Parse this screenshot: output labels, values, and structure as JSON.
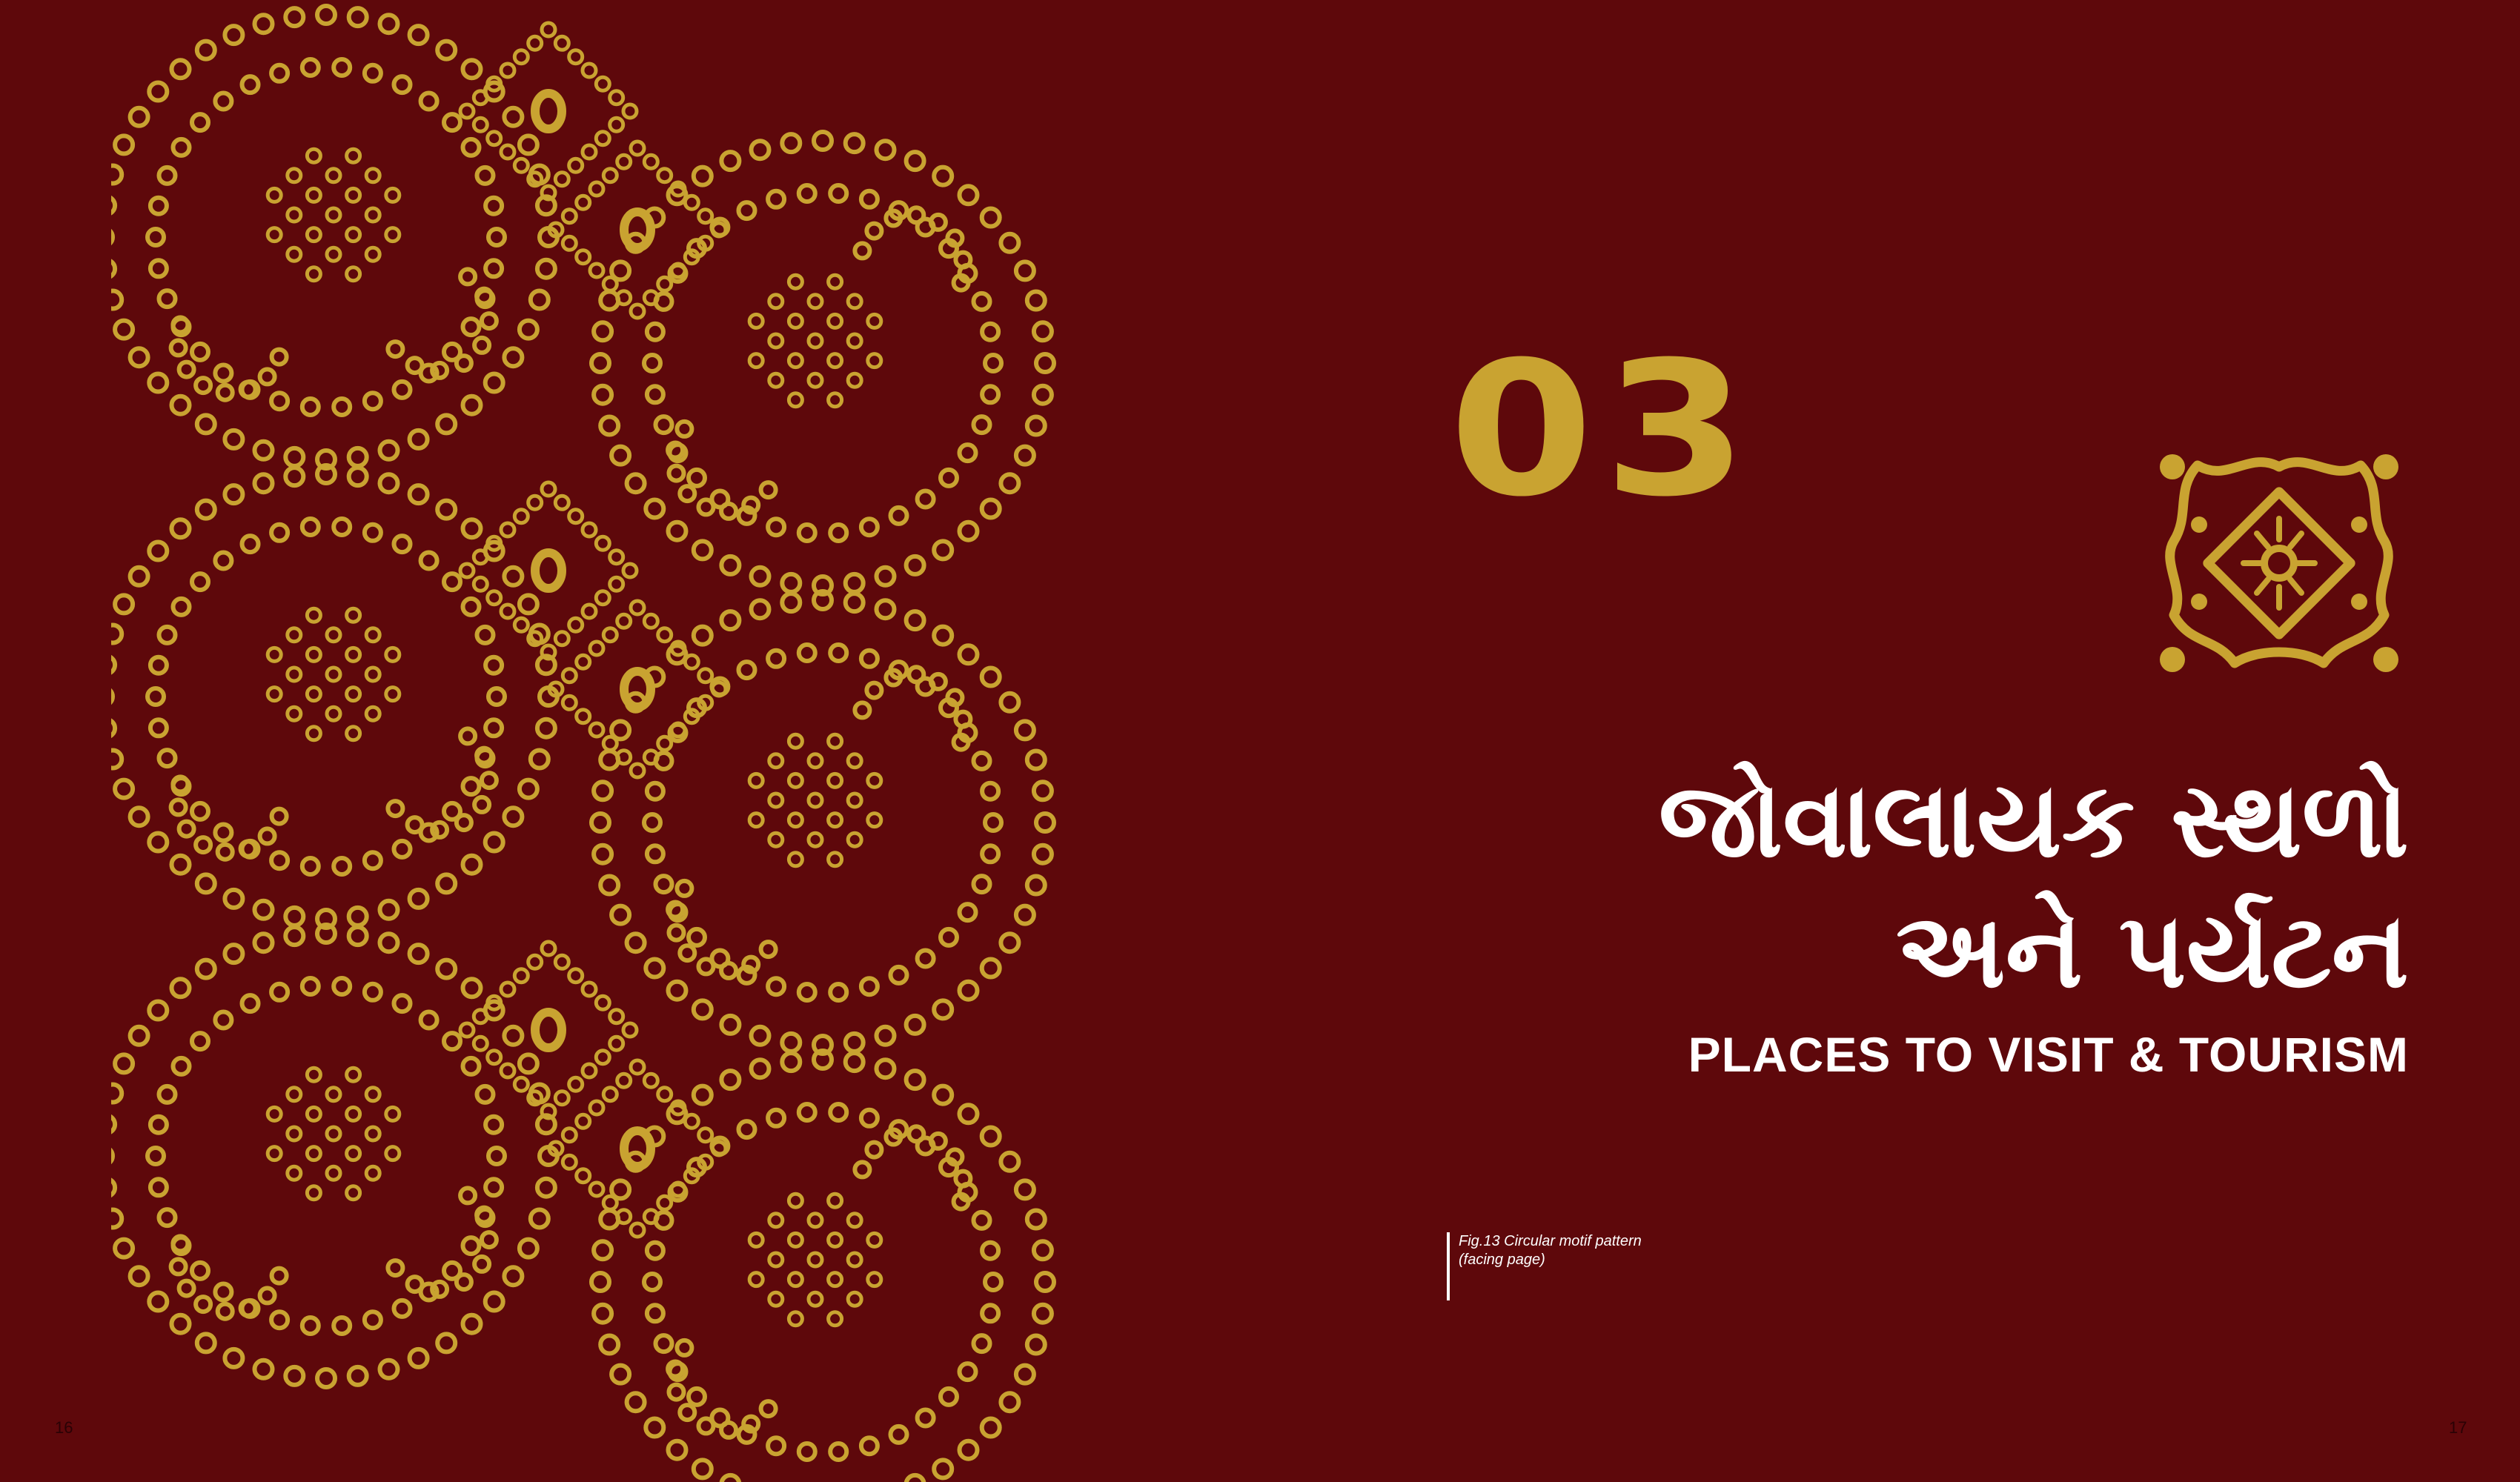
{
  "left_page": {
    "pattern_icon": "bandhani-dot-pattern",
    "page_number": "16"
  },
  "right_page": {
    "chapter_number": "03",
    "ornament_icon": "bandhani-square-motif",
    "title_gujarati_line1": "જોવાલાયક સ્થળો",
    "title_gujarati_line2": "અને પર્યટન",
    "title_english": "PLACES TO VISIT & TOURISM",
    "caption_line1": "Fig.13 Circular motif pattern",
    "caption_line2": "(facing page)",
    "page_number": "17"
  },
  "colors": {
    "background": "#5e080b",
    "gold": "#c9a331",
    "text": "#ffffff"
  }
}
